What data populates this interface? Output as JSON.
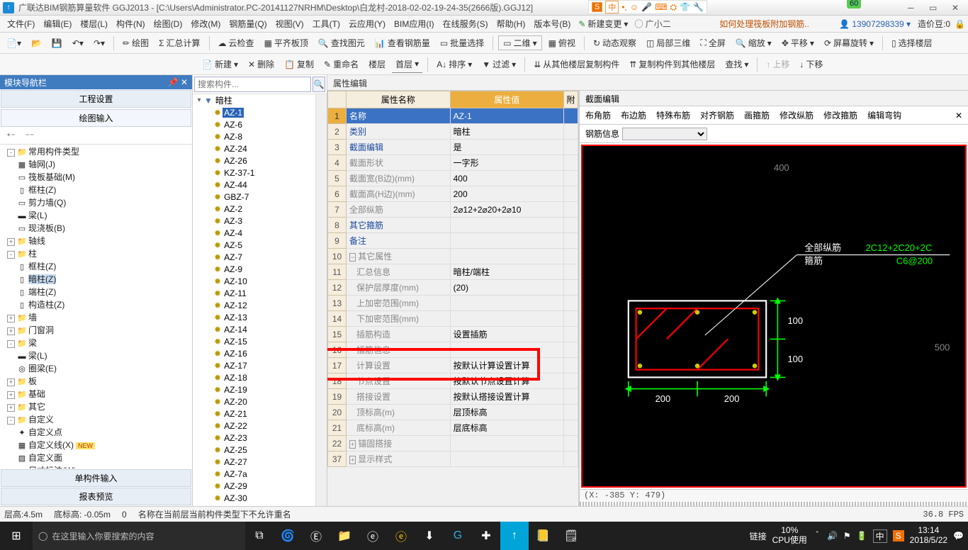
{
  "title": "广联达BIM钢筋算量软件 GGJ2013 - [C:\\Users\\Administrator.PC-20141127NRHM\\Desktop\\白龙村-2018-02-02-19-24-35(2666版).GGJ12]",
  "menus": [
    "文件(F)",
    "编辑(E)",
    "楼层(L)",
    "构件(N)",
    "绘图(D)",
    "修改(M)",
    "钢筋量(Q)",
    "视图(V)",
    "工具(T)",
    "云应用(Y)",
    "BIM应用(I)",
    "在线服务(S)",
    "帮助(H)",
    "版本号(B)"
  ],
  "new_change": "新建变更",
  "user_name": "广小二",
  "news_link": "如何处理筏板附加钢筋..",
  "account_no": "13907298339",
  "credits_label": "造价豆:0",
  "badge": "60",
  "ime": {
    "brand": "S",
    "lang": "中",
    "items": [
      "中",
      "•,",
      "☺",
      "⌨",
      "⌂",
      "⛭",
      "✂",
      "♪"
    ]
  },
  "toolbar1": [
    "绘图",
    "汇总计算",
    "云检查",
    "平齐板顶",
    "查找图元",
    "查看钢筋量",
    "批量选择",
    "二维",
    "俯视",
    "动态观察",
    "局部三维",
    "全屏",
    "缩放",
    "平移",
    "屏幕旋转",
    "选择楼层"
  ],
  "toolbar2": {
    "new": "新建",
    "del": "删除",
    "copy": "复制",
    "rename": "重命名",
    "floor": "楼层",
    "floor_val": "首层",
    "sort": "排序",
    "filter": "过滤",
    "copy_from": "从其他楼层复制构件",
    "copy_to": "复制构件到其他楼层",
    "search": "查找",
    "up": "上移",
    "down": "下移"
  },
  "nav": {
    "header": "模块导航栏",
    "items": [
      "工程设置",
      "绘图输入",
      "单构件输入",
      "报表预览"
    ]
  },
  "tree": {
    "root": "常用构件类型",
    "root_children": [
      {
        "t": "轴网(J)",
        "i": "▦"
      },
      {
        "t": "筏板基础(M)",
        "i": "▭"
      },
      {
        "t": "框柱(Z)",
        "i": "▯"
      },
      {
        "t": "剪力墙(Q)",
        "i": "▭"
      },
      {
        "t": "梁(L)",
        "i": "▬"
      },
      {
        "t": "现浇板(B)",
        "i": "▭"
      }
    ],
    "groups": [
      {
        "t": "轴线",
        "open": false
      },
      {
        "t": "柱",
        "open": true,
        "children": [
          {
            "t": "框柱(Z)",
            "i": "▯"
          },
          {
            "t": "暗柱(Z)",
            "i": "▯",
            "sel": true
          },
          {
            "t": "端柱(Z)",
            "i": "▯"
          },
          {
            "t": "构造柱(Z)",
            "i": "▯"
          }
        ]
      },
      {
        "t": "墙",
        "open": false
      },
      {
        "t": "门窗洞",
        "open": false
      },
      {
        "t": "梁",
        "open": true,
        "children": [
          {
            "t": "梁(L)",
            "i": "▬"
          },
          {
            "t": "圈梁(E)",
            "i": "◎"
          }
        ]
      },
      {
        "t": "板",
        "open": false
      },
      {
        "t": "基础",
        "open": false
      },
      {
        "t": "其它",
        "open": false
      },
      {
        "t": "自定义",
        "open": true,
        "children": [
          {
            "t": "自定义点",
            "i": "✦"
          },
          {
            "t": "自定义线(X)",
            "i": "▦",
            "new": true
          },
          {
            "t": "自定义面",
            "i": "▨"
          },
          {
            "t": "尺寸标注(W)",
            "i": "↔"
          }
        ]
      }
    ]
  },
  "mid": {
    "search_ph": "搜索构件...",
    "root": "暗柱",
    "items": [
      "AZ-1",
      "AZ-6",
      "AZ-8",
      "AZ-24",
      "AZ-26",
      "KZ-37-1",
      "AZ-44",
      "GBZ-7",
      "AZ-2",
      "AZ-3",
      "AZ-4",
      "AZ-5",
      "AZ-7",
      "AZ-9",
      "AZ-10",
      "AZ-11",
      "AZ-12",
      "AZ-13",
      "AZ-14",
      "AZ-15",
      "AZ-16",
      "AZ-17",
      "AZ-18",
      "AZ-19",
      "AZ-20",
      "AZ-21",
      "AZ-22",
      "AZ-23",
      "AZ-25",
      "AZ-27",
      "AZ-7a",
      "AZ-29",
      "AZ-30"
    ],
    "selected": "AZ-1"
  },
  "prop": {
    "title": "属性编辑",
    "col_name": "属性名称",
    "col_val": "属性值",
    "col_att": "附",
    "rows": [
      {
        "n": "1",
        "name": "名称",
        "val": "AZ-1",
        "blue": true,
        "sel": true
      },
      {
        "n": "2",
        "name": "类别",
        "val": "暗柱",
        "blue": true
      },
      {
        "n": "3",
        "name": "截面编辑",
        "val": "是",
        "blue": true
      },
      {
        "n": "4",
        "name": "截面形状",
        "val": "一字形",
        "gray": true
      },
      {
        "n": "5",
        "name": "截面宽(B边)(mm)",
        "val": "400",
        "gray": true
      },
      {
        "n": "6",
        "name": "截面高(H边)(mm)",
        "val": "200",
        "gray": true
      },
      {
        "n": "7",
        "name": "全部纵筋",
        "val": "2⌀12+2⌀20+2⌀10",
        "gray": true
      },
      {
        "n": "8",
        "name": "其它箍筋",
        "val": "",
        "blue": true
      },
      {
        "n": "9",
        "name": "备注",
        "val": "",
        "blue": true
      },
      {
        "n": "10",
        "name": "其它属性",
        "val": "",
        "gray": true,
        "group": true
      },
      {
        "n": "11",
        "name": "汇总信息",
        "val": "暗柱/端柱",
        "gray": true,
        "indent": true
      },
      {
        "n": "12",
        "name": "保护层厚度(mm)",
        "val": "(20)",
        "gray": true,
        "indent": true
      },
      {
        "n": "13",
        "name": "上加密范围(mm)",
        "val": "",
        "gray": true,
        "indent": true
      },
      {
        "n": "14",
        "name": "下加密范围(mm)",
        "val": "",
        "gray": true,
        "indent": true
      },
      {
        "n": "15",
        "name": "插筋构造",
        "val": "设置插筋",
        "gray": true,
        "indent": true
      },
      {
        "n": "16",
        "name": "插筋信息",
        "val": "",
        "gray": true,
        "indent": true
      },
      {
        "n": "17",
        "name": "计算设置",
        "val": "按默认计算设置计算",
        "gray": true,
        "indent": true
      },
      {
        "n": "18",
        "name": "节点设置",
        "val": "按默认节点设置计算",
        "gray": true,
        "indent": true
      },
      {
        "n": "19",
        "name": "搭接设置",
        "val": "按默认搭接设置计算",
        "gray": true,
        "indent": true
      },
      {
        "n": "20",
        "name": "顶标高(m)",
        "val": "层顶标高",
        "gray": true,
        "indent": true
      },
      {
        "n": "21",
        "name": "底标高(m)",
        "val": "层底标高",
        "gray": true,
        "indent": true
      },
      {
        "n": "22",
        "name": "锚固搭接",
        "val": "",
        "gray": true,
        "group": true
      },
      {
        "n": "37",
        "name": "显示样式",
        "val": "",
        "gray": true,
        "group": true
      }
    ]
  },
  "section": {
    "title": "截面编辑",
    "tabs": [
      "布角筋",
      "布边筋",
      "特殊布筋",
      "对齐钢筋",
      "画箍筋",
      "修改纵筋",
      "修改箍筋",
      "编辑弯钩"
    ],
    "rebar_label": "钢筋信息",
    "labels": {
      "all": "全部纵筋",
      "rebar": "2C12+2C20+2C",
      "stirrup": "箍筋",
      "stirrup_val": "C6@200",
      "h1": "100",
      "h2": "100",
      "w1": "200",
      "w2": "200",
      "tick400": "400",
      "tick500": "500"
    },
    "coord": "(X: -385 Y: 479)"
  },
  "status": {
    "h": "层高:4.5m",
    "b": "底标高: -0.05m",
    "z": "0",
    "msg": "名称在当前层当前构件类型下不允许重名",
    "fps": "36.8 FPS"
  },
  "taskbar": {
    "search_ph": "在这里输入你要搜索的内容",
    "label1": "链接",
    "cpu_pct": "10%",
    "cpu_lbl": "CPU使用",
    "ime_ch": "中",
    "time": "13:14",
    "date": "2018/5/22"
  }
}
